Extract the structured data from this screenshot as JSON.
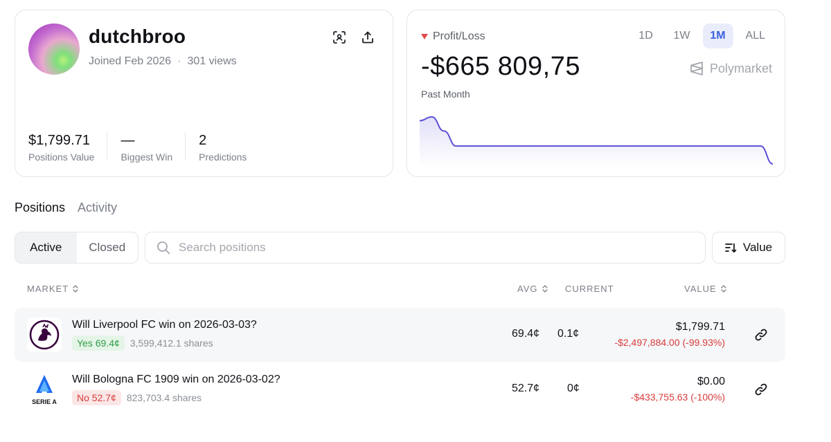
{
  "profile": {
    "username": "dutchbroo",
    "joined": "Joined Feb 2026",
    "separator": "·",
    "views": "301 views",
    "stats": [
      {
        "value": "$1,799.71",
        "label": "Positions Value"
      },
      {
        "value": "—",
        "label": "Biggest Win"
      },
      {
        "value": "2",
        "label": "Predictions"
      }
    ],
    "icons": [
      "scan-icon",
      "share-icon"
    ]
  },
  "pnl": {
    "label": "Profit/Loss",
    "value": "-$665 809,75",
    "period": "Past Month",
    "ranges": [
      "1D",
      "1W",
      "1M",
      "ALL"
    ],
    "active_range": "1M",
    "brand": "Polymarket",
    "line_color": "#5b4fd6",
    "trend": [
      0.92,
      1.0,
      0.7,
      0.38,
      0.38,
      0.38,
      0.38,
      0.38,
      0.38,
      0.38,
      0.38,
      0.38,
      0.38,
      0.38,
      0.38,
      0.38,
      0.38,
      0.38,
      0.38,
      0.38,
      0.38,
      0.38,
      0.38,
      0.38,
      0.38,
      0.38,
      0.38,
      0.38,
      0.38,
      0.0
    ]
  },
  "tabs": [
    "Positions",
    "Activity"
  ],
  "filters": {
    "active_label": "Active",
    "closed_label": "Closed",
    "search_placeholder": "Search positions",
    "sort_label": "Value"
  },
  "table": {
    "headers": {
      "market": "MARKET",
      "avg": "AVG",
      "current": "CURRENT",
      "value": "VALUE"
    },
    "rows": [
      {
        "title": "Will Liverpool FC win on 2026-03-03?",
        "outcome": "Yes 69.4¢",
        "shares": "3,599,412.1 shares",
        "avg": "69.4¢",
        "current": "0.1¢",
        "value": "$1,799.71",
        "pnl": "-$2,497,884.00 (-99.93%)",
        "logo": "premier-league-logo"
      },
      {
        "title": "Will Bologna FC 1909 win on 2026-03-02?",
        "outcome": "No 52.7¢",
        "shares": "823,703.4 shares",
        "avg": "52.7¢",
        "current": "0¢",
        "value": "$0.00",
        "pnl": "-$433,755.63 (-100%)",
        "logo": "serie-a-logo",
        "logo_text": "SERIE A"
      }
    ]
  }
}
